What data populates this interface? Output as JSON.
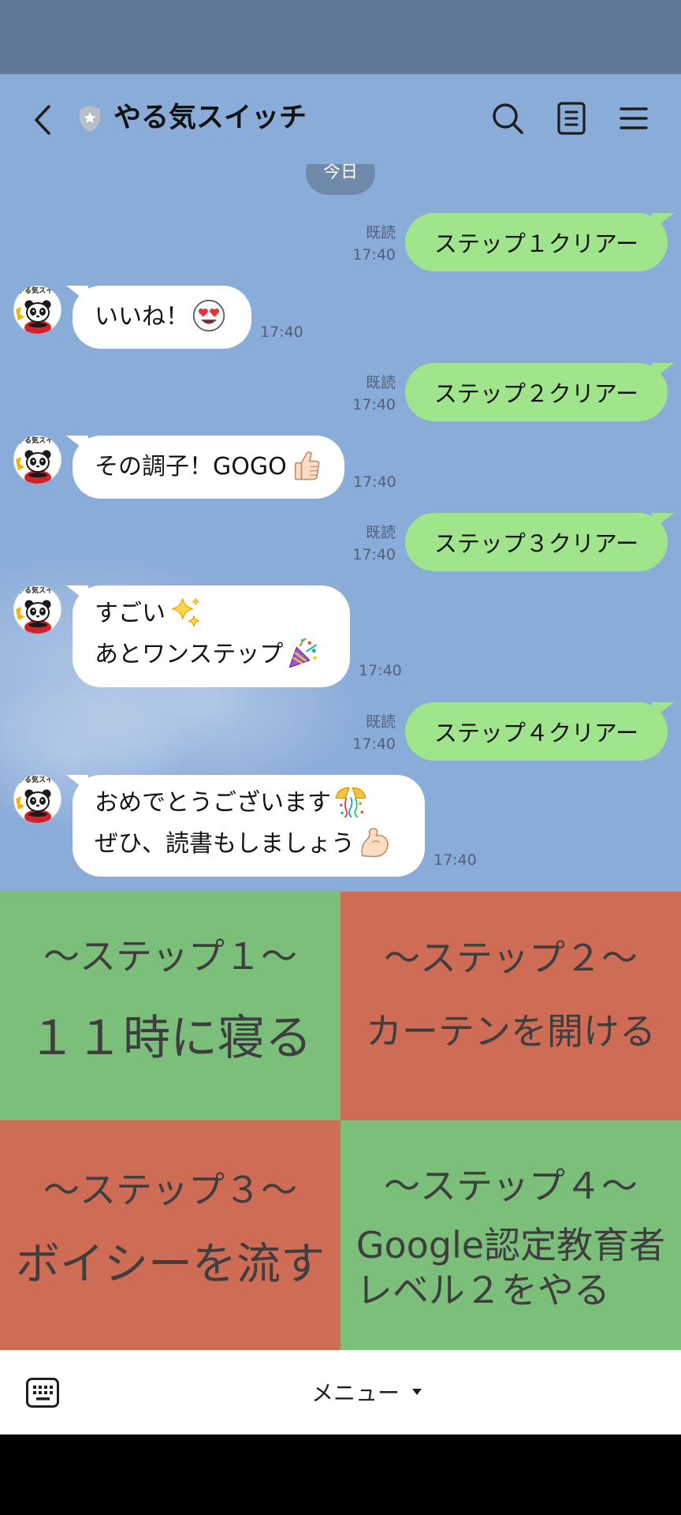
{
  "colors": {
    "status_bar": "#627898",
    "chat_background": "#8aacd9",
    "sent_bubble": "#a0e58c",
    "received_bubble": "#ffffff",
    "meta_text": "#506079"
  },
  "header": {
    "title": "やる気スイッチ",
    "icons": {
      "back": "chevron-left-icon",
      "official_badge": "shield-star-icon",
      "search": "search-icon",
      "notes": "note-icon",
      "menu": "hamburger-menu-icon"
    }
  },
  "date_divider": "今日",
  "avatar": {
    "logo_text": "やる気スイッチ"
  },
  "messages": [
    {
      "side": "sent",
      "text": "ステップ１クリアー",
      "read": "既読",
      "time": "17:40"
    },
    {
      "side": "received",
      "lines": [
        {
          "text": "いいね！",
          "emoji": "smiling-face-with-heart-eyes"
        }
      ],
      "time": "17:40"
    },
    {
      "side": "sent",
      "text": "ステップ２クリアー",
      "read": "既読",
      "time": "17:40"
    },
    {
      "side": "received",
      "lines": [
        {
          "text": "その調子！GOGO",
          "emoji": "thumbs-up"
        }
      ],
      "time": "17:40"
    },
    {
      "side": "sent",
      "text": "ステップ３クリアー",
      "read": "既読",
      "time": "17:40"
    },
    {
      "side": "received",
      "lines": [
        {
          "text": "すごい",
          "emoji": "sparkles"
        },
        {
          "text": "あとワンステップ",
          "emoji": "party-popper"
        }
      ],
      "time": "17:40"
    },
    {
      "side": "sent",
      "text": "ステップ４クリアー",
      "read": "既読",
      "time": "17:40"
    },
    {
      "side": "received",
      "lines": [
        {
          "text": "おめでとうございます",
          "emoji": "confetti-ball"
        },
        {
          "text": "ぜひ、読書もしましょう",
          "emoji": "flexed-biceps"
        }
      ],
      "time": "17:40"
    }
  ],
  "rich_menu": {
    "tiles": [
      {
        "heading": "～ステップ１～",
        "lines": [
          "１１時に寝る"
        ],
        "color": "#7bbf7b"
      },
      {
        "heading": "～ステップ２～",
        "lines": [
          "カーテンを開ける"
        ],
        "color": "#cf6c55"
      },
      {
        "heading": "～ステップ３～",
        "lines": [
          "ボイシーを流す"
        ],
        "color": "#cf6c55"
      },
      {
        "heading": "～ステップ４～",
        "lines": [
          "Google認定教育者",
          "レベル２をやる"
        ],
        "color": "#7bbf7b"
      }
    ]
  },
  "bottom_bar": {
    "keyboard_icon": "keyboard-icon",
    "menu_label": "メニュー",
    "menu_caret_icon": "caret-down-icon"
  }
}
